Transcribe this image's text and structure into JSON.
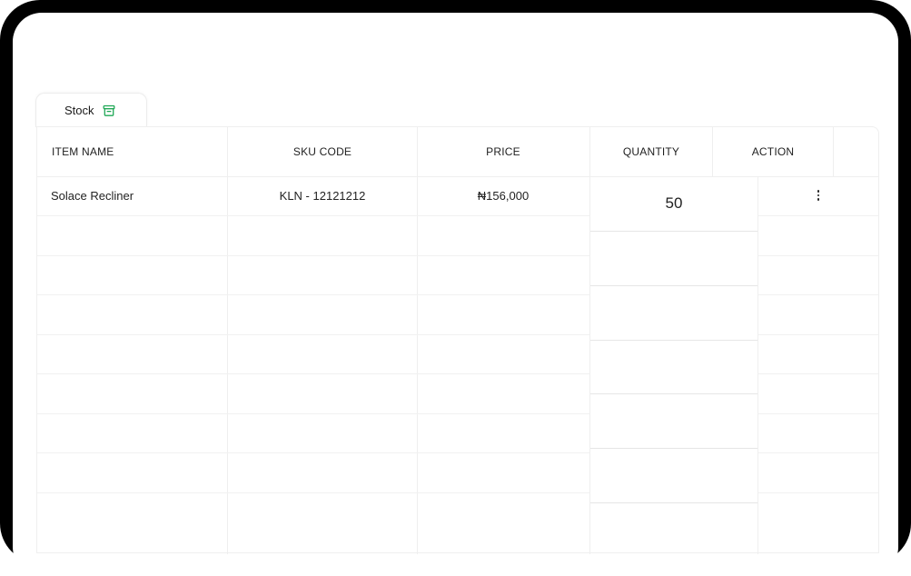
{
  "tab": {
    "label": "Stock",
    "icon": "archive-box-icon",
    "icon_color": "#1fa855"
  },
  "table": {
    "headers": {
      "item_name": "ITEM NAME",
      "sku_code": "SKU CODE",
      "price": "PRICE",
      "quantity": "QUANTITY",
      "action": "ACTION"
    },
    "rows": [
      {
        "item_name": "Solace Recliner",
        "sku_code": "KLN - 12121212",
        "price": "₦156,000",
        "quantity": "50"
      }
    ]
  }
}
